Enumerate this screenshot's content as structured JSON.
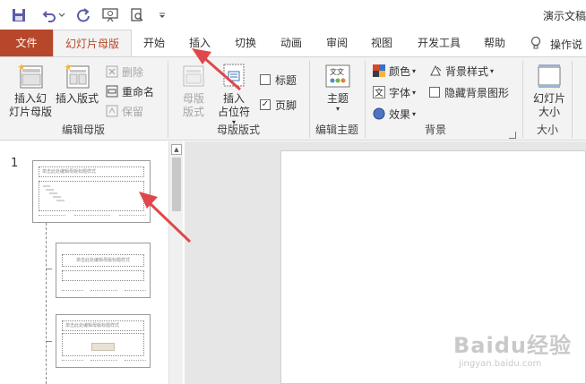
{
  "window": {
    "title": "演示文稿"
  },
  "quick_access": [
    "save-icon",
    "undo-icon",
    "redo-icon",
    "slideshow-icon",
    "preview-icon",
    "customize-icon"
  ],
  "tabs": [
    {
      "label": "文件"
    },
    {
      "label": "幻灯片母版"
    },
    {
      "label": "开始"
    },
    {
      "label": "插入"
    },
    {
      "label": "切换"
    },
    {
      "label": "动画"
    },
    {
      "label": "审阅"
    },
    {
      "label": "视图"
    },
    {
      "label": "开发工具"
    },
    {
      "label": "帮助"
    }
  ],
  "tell_me": "操作说",
  "ribbon": {
    "edit_master": {
      "label": "编辑母版",
      "insert_master_l1": "插入幻",
      "insert_master_l2": "灯片母版",
      "insert_layout": "插入版式",
      "delete": "删除",
      "rename": "重命名",
      "preserve": "保留"
    },
    "master_layout": {
      "label": "母版版式",
      "master_layout_l1": "母版",
      "master_layout_l2": "版式",
      "insert_placeholder_l1": "插入",
      "insert_placeholder_l2": "占位符",
      "title_check": "标题",
      "footer_check": "页脚",
      "title_checked": false,
      "footer_checked": true
    },
    "edit_theme": {
      "label": "编辑主题",
      "themes": "主题"
    },
    "background": {
      "label": "背景",
      "colors": "颜色",
      "fonts": "字体",
      "effects": "效果",
      "bg_styles": "背景样式",
      "hide_bg": "隐藏背景图形"
    },
    "size": {
      "label": "大小",
      "slide_size_l1": "幻灯片",
      "slide_size_l2": "大小"
    }
  },
  "thumbnails": {
    "slide_number": "1",
    "master_title": "单击此处编辑母版标题样式",
    "layout1_title": "单击此处编辑母版标题样式",
    "layout2_title": "单击此处编辑母版标题样式"
  },
  "watermark": {
    "brand": "Baidu经验",
    "url": "jingyan.baidu.com"
  },
  "colors": {
    "accent": "#b7472a",
    "ribbon_bg": "#f3f3f3",
    "arrow": "#e0474c"
  }
}
